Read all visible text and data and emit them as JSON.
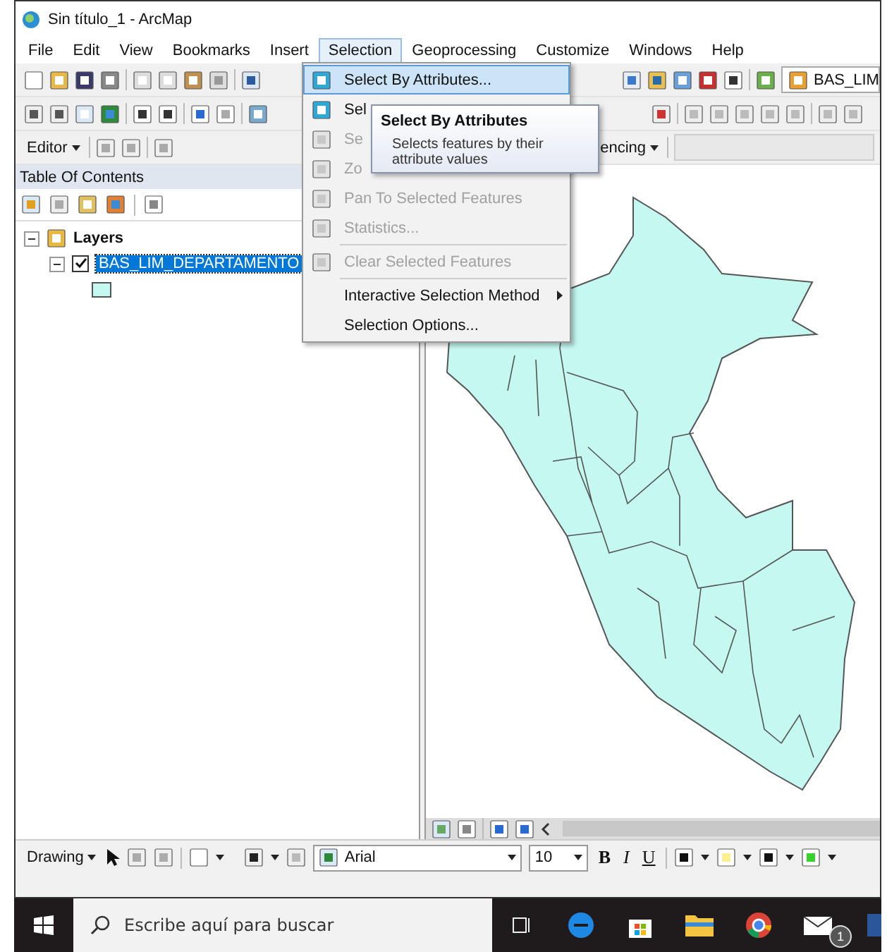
{
  "window": {
    "title": "Sin título_1 - ArcMap"
  },
  "menu_bar": [
    {
      "label": "File",
      "selected": false
    },
    {
      "label": "Edit",
      "selected": false
    },
    {
      "label": "View",
      "selected": false
    },
    {
      "label": "Bookmarks",
      "selected": false
    },
    {
      "label": "Insert",
      "selected": false
    },
    {
      "label": "Selection",
      "selected": true
    },
    {
      "label": "Geoprocessing",
      "selected": false
    },
    {
      "label": "Customize",
      "selected": false
    },
    {
      "label": "Windows",
      "selected": false
    },
    {
      "label": "Help",
      "selected": false
    }
  ],
  "standard_toolbar": {
    "layer_combo": "BAS_LIM"
  },
  "editor_toolbar": {
    "editor_menu": "Editor",
    "georeferencing_menu": "encing"
  },
  "table_of_contents": {
    "title": "Table Of Contents",
    "group": {
      "label": "Layers",
      "expanded": true,
      "children": [
        {
          "label": "BAS_LIM_DEPARTAMENTO",
          "checked": true,
          "selected": true,
          "expanded": true
        }
      ]
    }
  },
  "selection_menu": {
    "items": [
      {
        "kind": "icon_item",
        "label": "Select By Attributes...",
        "disabled": false,
        "selected": true
      },
      {
        "kind": "icon_item",
        "label": "Sel",
        "disabled": false,
        "selected": false
      },
      {
        "kind": "icon_item",
        "label": "Se",
        "disabled": true,
        "selected": false
      },
      {
        "kind": "icon_item",
        "label": "Zo",
        "disabled": true,
        "selected": false
      },
      {
        "kind": "icon_item",
        "label": "Pan To Selected Features",
        "disabled": true,
        "selected": false
      },
      {
        "kind": "icon_item",
        "label": "Statistics...",
        "disabled": true,
        "selected": false
      },
      {
        "kind": "separator"
      },
      {
        "kind": "icon_item",
        "label": "Clear Selected Features",
        "disabled": true,
        "selected": false
      },
      {
        "kind": "separator"
      },
      {
        "kind": "item",
        "label": "Interactive Selection Method",
        "disabled": false,
        "selected": false,
        "submenu": true
      },
      {
        "kind": "item",
        "label": "Selection Options...",
        "disabled": false,
        "selected": false
      }
    ]
  },
  "tooltip": {
    "title": "Select By Attributes",
    "text": "Selects features by their attribute values"
  },
  "drawing_toolbar": {
    "drawing_menu": "Drawing",
    "font": "Arial",
    "font_size": "10",
    "bold": "B",
    "italic": "I",
    "underline": "U"
  },
  "taskbar": {
    "search_placeholder": "Escribe aquí para buscar",
    "mail_badge": "1"
  }
}
